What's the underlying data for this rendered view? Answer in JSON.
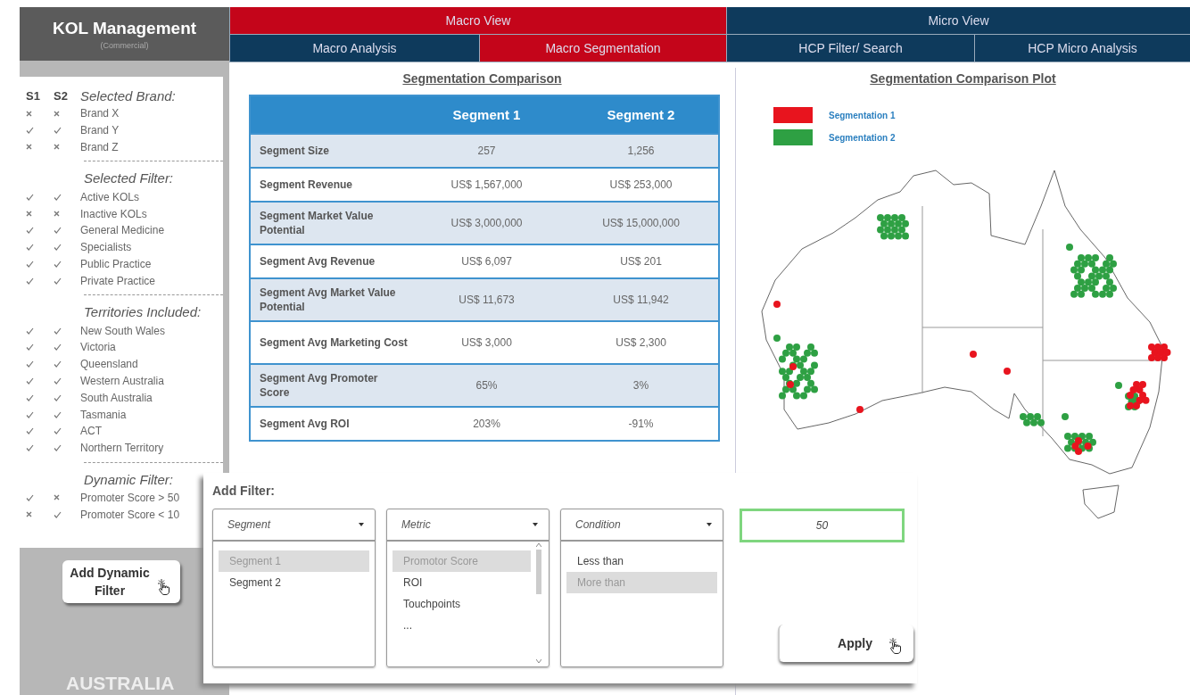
{
  "sidebar": {
    "title": "KOL Management",
    "subtitle": "(Commercial)",
    "columns": [
      "S1",
      "S2"
    ],
    "sections": [
      {
        "heading": "Selected Brand:",
        "items": [
          {
            "label": "Brand X",
            "s1": false,
            "s2": false
          },
          {
            "label": "Brand Y",
            "s1": true,
            "s2": true
          },
          {
            "label": "Brand Z",
            "s1": false,
            "s2": false
          }
        ]
      },
      {
        "heading": "Selected Filter:",
        "items": [
          {
            "label": "Active KOLs",
            "s1": true,
            "s2": true
          },
          {
            "label": "Inactive KOLs",
            "s1": false,
            "s2": false
          },
          {
            "label": "General Medicine",
            "s1": true,
            "s2": true
          },
          {
            "label": "Specialists",
            "s1": true,
            "s2": true
          },
          {
            "label": "Public Practice",
            "s1": true,
            "s2": true
          },
          {
            "label": "Private Practice",
            "s1": true,
            "s2": true
          }
        ]
      },
      {
        "heading": "Territories Included:",
        "items": [
          {
            "label": "New South Wales",
            "s1": true,
            "s2": true
          },
          {
            "label": "Victoria",
            "s1": true,
            "s2": true
          },
          {
            "label": "Queensland",
            "s1": true,
            "s2": true
          },
          {
            "label": "Western Australia",
            "s1": true,
            "s2": true
          },
          {
            "label": "South Australia",
            "s1": true,
            "s2": true
          },
          {
            "label": "Tasmania",
            "s1": true,
            "s2": true
          },
          {
            "label": "ACT",
            "s1": true,
            "s2": true
          },
          {
            "label": "Northern Territory",
            "s1": true,
            "s2": true
          }
        ]
      },
      {
        "heading": "Dynamic Filter:",
        "items": [
          {
            "label": "Promoter Score > 50",
            "s1": true,
            "s2": false
          },
          {
            "label": "Promoter Score < 10",
            "s1": false,
            "s2": true
          }
        ]
      }
    ],
    "button": "Add Dynamic Filter",
    "region": "AUSTRALIA"
  },
  "nav": [
    {
      "label": "Macro View",
      "selected": true,
      "tabs": [
        {
          "label": "Macro Analysis",
          "selected": false
        },
        {
          "label": "Macro Segmentation",
          "selected": true
        }
      ]
    },
    {
      "label": "Micro View",
      "selected": false,
      "tabs": [
        {
          "label": "HCP Filter/ Search",
          "selected": false
        },
        {
          "label": "HCP Micro Analysis",
          "selected": false
        }
      ]
    }
  ],
  "comparison": {
    "title": "Segmentation Comparison",
    "columns": [
      "Segment 1",
      "Segment 2"
    ],
    "rows": [
      {
        "label": "Segment Size",
        "values": [
          "257",
          "1,256"
        ]
      },
      {
        "label": "Segment Revenue",
        "values": [
          "US$ 1,567,000",
          "US$ 253,000"
        ]
      },
      {
        "label": "Segment Market Value Potential",
        "values": [
          "US$ 3,000,000",
          "US$ 15,000,000"
        ]
      },
      {
        "label": "Segment Avg Revenue",
        "values": [
          "US$ 6,097",
          "US$ 201"
        ]
      },
      {
        "label": "Segment Avg Market Value Potential",
        "values": [
          "US$ 11,673",
          "US$ 11,942"
        ]
      },
      {
        "label": "Segment Avg Marketing Cost",
        "values": [
          "US$ 3,000",
          "US$ 2,300"
        ]
      },
      {
        "label": "Segment Avg Promoter Score",
        "values": [
          "65%",
          "3%"
        ]
      },
      {
        "label": "Segment Avg ROI",
        "values": [
          "203%",
          "-91%"
        ]
      }
    ]
  },
  "plot": {
    "title": "Segmentation Comparison Plot",
    "legend": [
      {
        "label": "Segmentation 1",
        "color": "#e8141e"
      },
      {
        "label": "Segmentation 2",
        "color": "#2ea043"
      }
    ]
  },
  "filter_dialog": {
    "title": "Add Filter:",
    "lists": [
      {
        "header": "Segment",
        "scrollable": false,
        "options": [
          {
            "label": "Segment 1",
            "selected": true
          },
          {
            "label": "Segment 2",
            "selected": false
          }
        ]
      },
      {
        "header": "Metric",
        "scrollable": true,
        "options": [
          {
            "label": "Promotor Score",
            "selected": true
          },
          {
            "label": "ROI",
            "selected": false
          },
          {
            "label": "Touchpoints",
            "selected": false
          },
          {
            "label": "...",
            "selected": false
          }
        ]
      },
      {
        "header": "Condition",
        "scrollable": false,
        "options": [
          {
            "label": "Less than",
            "selected": false
          },
          {
            "label": "More than",
            "selected": true
          }
        ]
      }
    ],
    "value": "50",
    "button": "Apply"
  }
}
